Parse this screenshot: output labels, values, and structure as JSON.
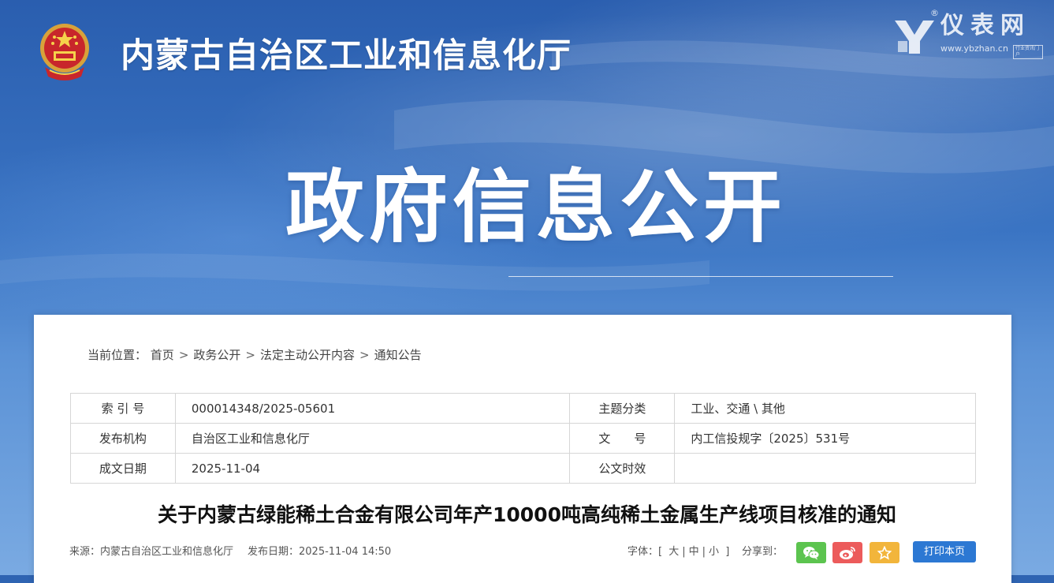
{
  "site": {
    "title": "内蒙古自治区工业和信息化厅",
    "banner_heading": "政府信息公开"
  },
  "watermark": {
    "name": "仪表网",
    "url": "www.ybzhan.cn",
    "tag": "行业资讯门户",
    "reg": "®"
  },
  "breadcrumb": {
    "prefix": "当前位置：",
    "items": [
      "首页",
      "政务公开",
      "法定主动公开内容",
      "通知公告"
    ],
    "separator": ">"
  },
  "meta": {
    "rows": [
      {
        "label1": "索 引 号",
        "value1": "000014348/2025-05601",
        "label2": "主题分类",
        "value2": "工业、交通 \\ 其他"
      },
      {
        "label1": "发布机构",
        "value1": "自治区工业和信息化厅",
        "label2": "文　　号",
        "value2": "内工信投规字〔2025〕531号"
      },
      {
        "label1": "成文日期",
        "value1": "2025-11-04",
        "label2": "公文时效",
        "value2": ""
      }
    ]
  },
  "article": {
    "title": "关于内蒙古绿能稀土合金有限公司年产10000吨高纯稀土金属生产线项目核准的通知",
    "source": "来源：内蒙古自治区工业和信息化厅",
    "published": "发布日期：2025-11-04 14:50"
  },
  "toolbar": {
    "font_label": "字体：",
    "font_open": "[",
    "font_close": "]",
    "font_large": "大",
    "font_medium": "中",
    "font_small": "小",
    "font_sep": "|",
    "share_label": "分享到：",
    "print_label": "打印本页"
  },
  "colors": {
    "banner_blue": "#2f64b2",
    "wechat": "#5cc44f",
    "weibo": "#ec5b5b",
    "favorite": "#f2b53b",
    "print": "#2c78d3"
  },
  "icons": {
    "emblem": "national-emblem-icon",
    "wechat": "wechat-icon",
    "weibo": "weibo-icon",
    "favorite": "star-icon"
  }
}
